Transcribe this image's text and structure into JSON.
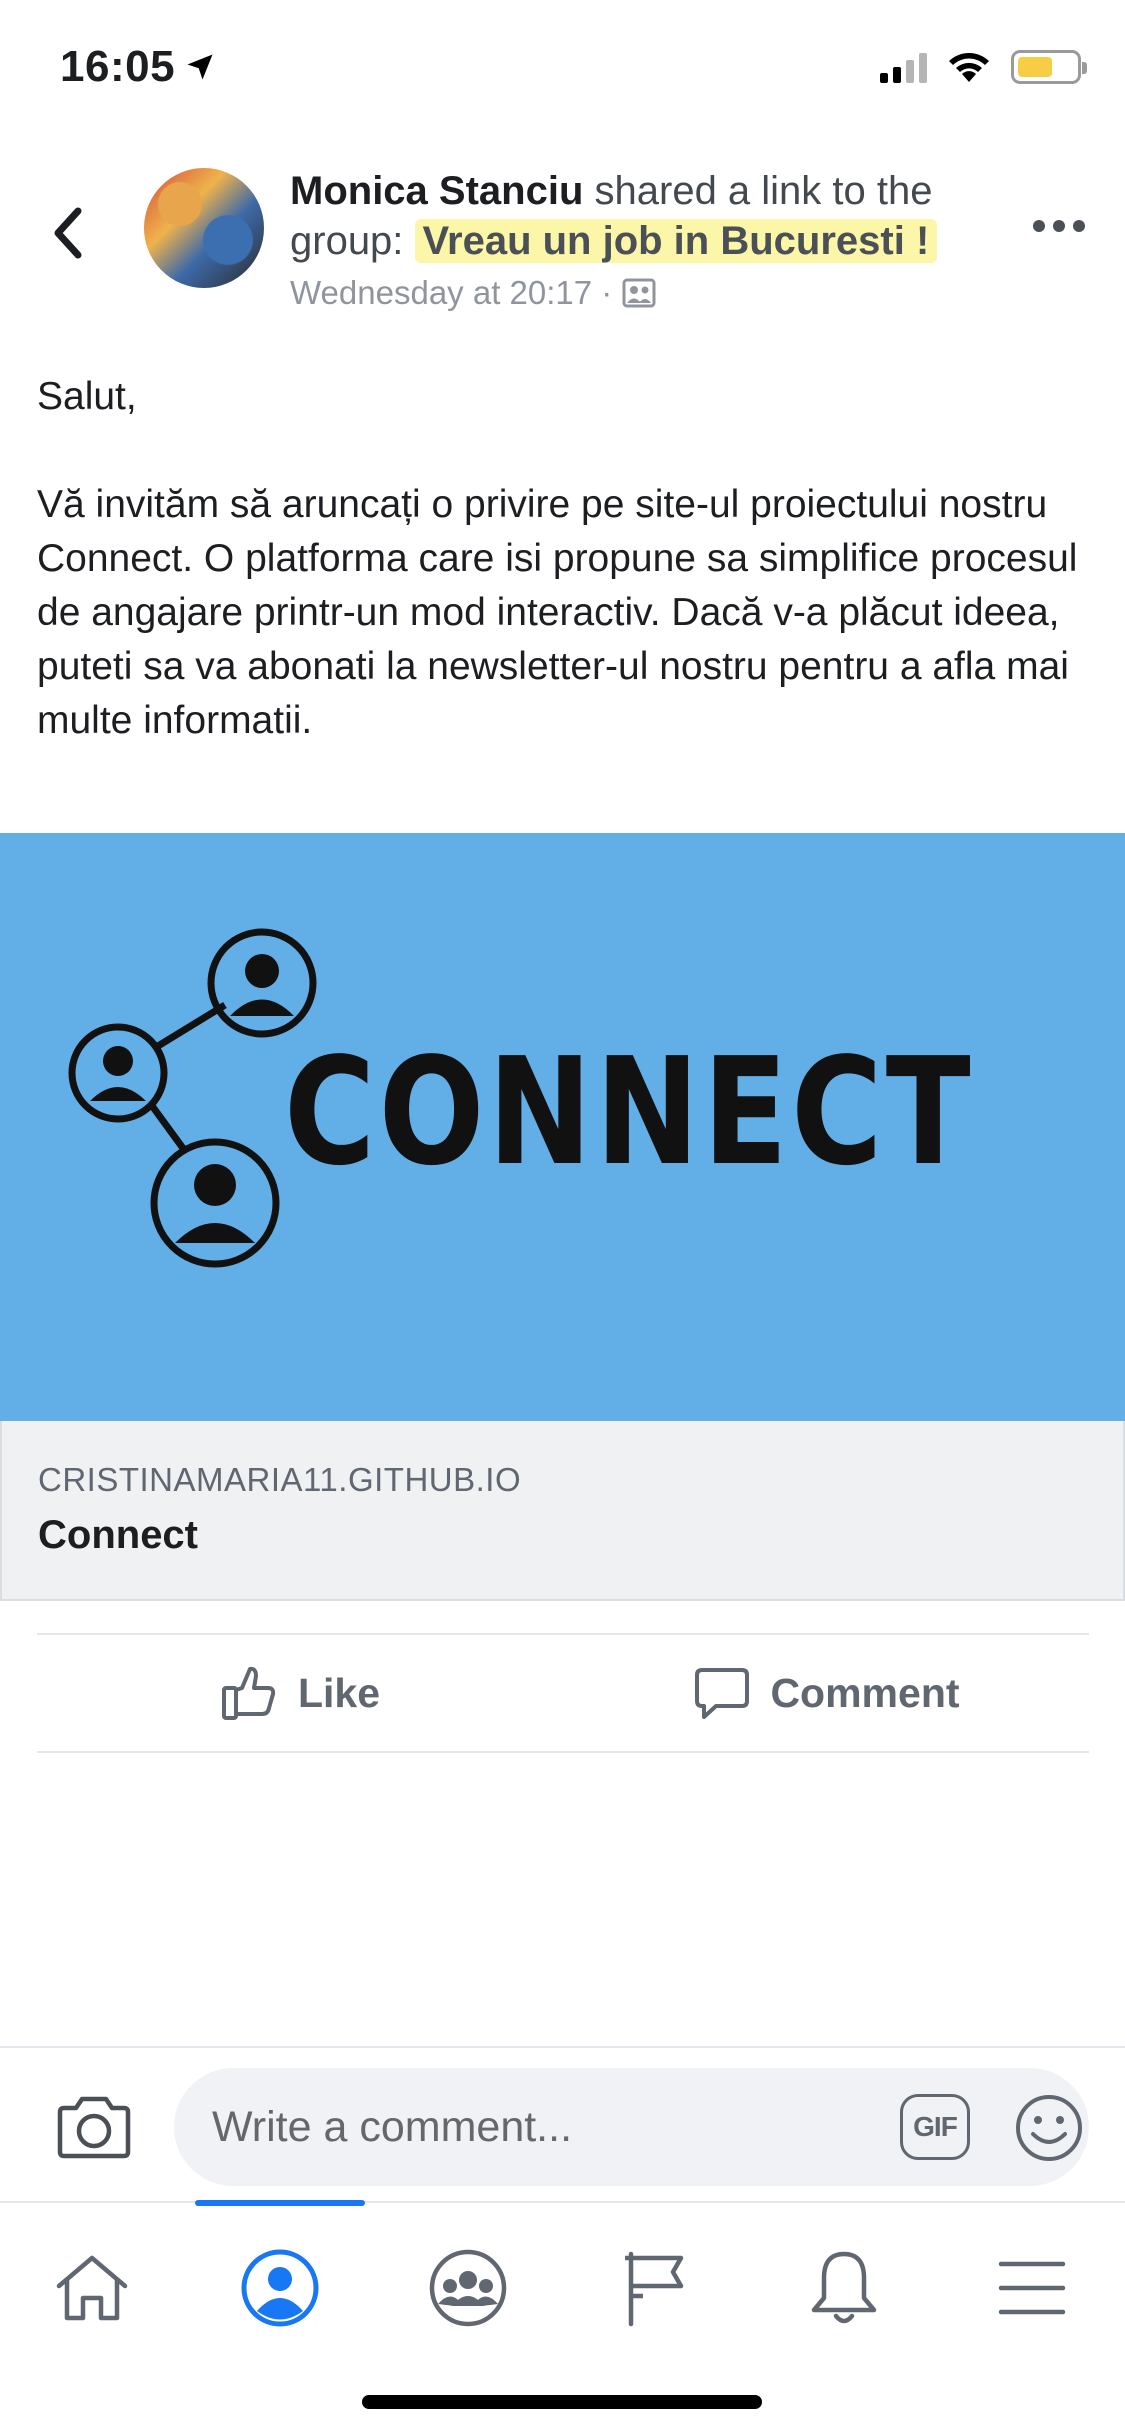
{
  "status_bar": {
    "time": "16:05",
    "battery_color": "#f7cd46"
  },
  "post": {
    "author": "Monica Stanciu",
    "action_text": " shared a link to the group: ",
    "group": "Vreau un job in Bucuresti !",
    "timestamp": "Wednesday at 20:17 ·",
    "body": {
      "greeting": "Salut,",
      "paragraph": "Vă invităm să aruncați o privire pe site-ul proiectului nostru Connect. O platforma care isi propune sa simplifice procesul de angajare printr-un mod interactiv. Dacă v-a plăcut ideea, puteti sa va abonati la newsletter-ul nostru pentru a afla mai multe informatii."
    }
  },
  "link_preview": {
    "logo_text": "CONNECT",
    "domain": "CRISTINAMARIA11.GITHUB.IO",
    "title": "Connect",
    "background_color": "#62afe8"
  },
  "actions": {
    "like_label": "Like",
    "comment_label": "Comment"
  },
  "composer": {
    "placeholder": "Write a comment...",
    "gif_label": "GIF"
  },
  "bottom_nav": {
    "items": [
      "home-icon",
      "profile-icon",
      "groups-icon",
      "pages-flag-icon",
      "notifications-bell-icon",
      "menu-icon"
    ],
    "active": "profile-icon",
    "accent_color": "#1877f2"
  }
}
